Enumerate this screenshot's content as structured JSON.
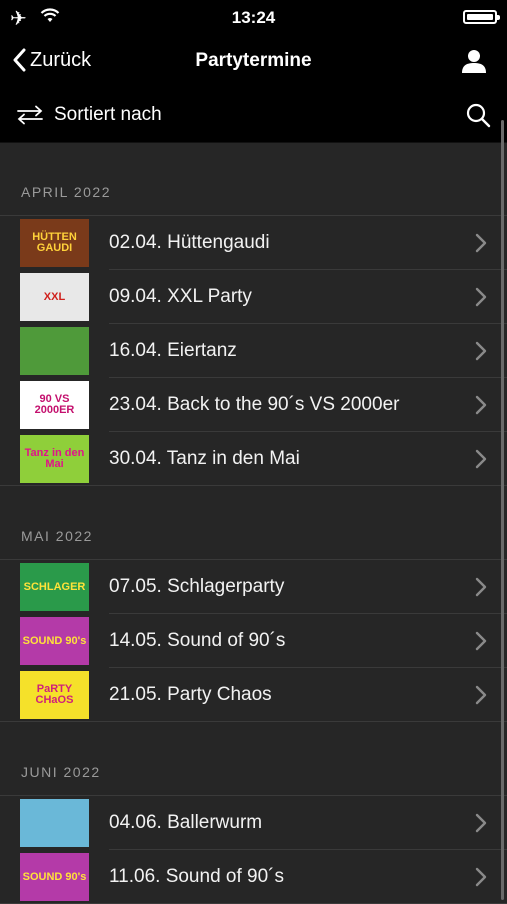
{
  "status_bar": {
    "time": "13:24"
  },
  "navbar": {
    "back_label": "Zurück",
    "title": "Partytermine"
  },
  "sortbar": {
    "label": "Sortiert nach"
  },
  "sections": [
    {
      "header": "APRIL 2022",
      "items": [
        {
          "label": "02.04. Hüttengaudi",
          "thumb_text": "HÜTTEN GAUDI",
          "thumb_bg": "#7a3a1a",
          "thumb_fg": "#ffd23a"
        },
        {
          "label": "09.04. XXL Party",
          "thumb_text": "XXL",
          "thumb_bg": "#e8e8e8",
          "thumb_fg": "#d0201c"
        },
        {
          "label": "16.04. Eiertanz",
          "thumb_text": "",
          "thumb_bg": "#4f9a3a",
          "thumb_fg": "#ffffff"
        },
        {
          "label": "23.04. Back to the 90´s VS 2000er",
          "thumb_text": "90 VS 2000ER",
          "thumb_bg": "#ffffff",
          "thumb_fg": "#c4106e"
        },
        {
          "label": "30.04. Tanz in den Mai",
          "thumb_text": "Tanz in den Mai",
          "thumb_bg": "#8fcf3a",
          "thumb_fg": "#e0138a"
        }
      ]
    },
    {
      "header": "MAI 2022",
      "items": [
        {
          "label": "07.05. Schlagerparty",
          "thumb_text": "SCHLAGER",
          "thumb_bg": "#2a9a4a",
          "thumb_fg": "#ffe23a"
        },
        {
          "label": "14.05. Sound of 90´s",
          "thumb_text": "SOUND 90's",
          "thumb_bg": "#b43aa8",
          "thumb_fg": "#ffe23a"
        },
        {
          "label": "21.05. Party Chaos",
          "thumb_text": "PaRTY CHaOS",
          "thumb_bg": "#f5e12a",
          "thumb_fg": "#d0207a"
        }
      ]
    },
    {
      "header": "JUNI 2022",
      "items": [
        {
          "label": "04.06. Ballerwurm",
          "thumb_text": "",
          "thumb_bg": "#6ab8d8",
          "thumb_fg": "#ffffff"
        },
        {
          "label": "11.06. Sound of 90´s",
          "thumb_text": "SOUND 90's",
          "thumb_bg": "#b43aa8",
          "thumb_fg": "#ffe23a"
        }
      ]
    }
  ]
}
